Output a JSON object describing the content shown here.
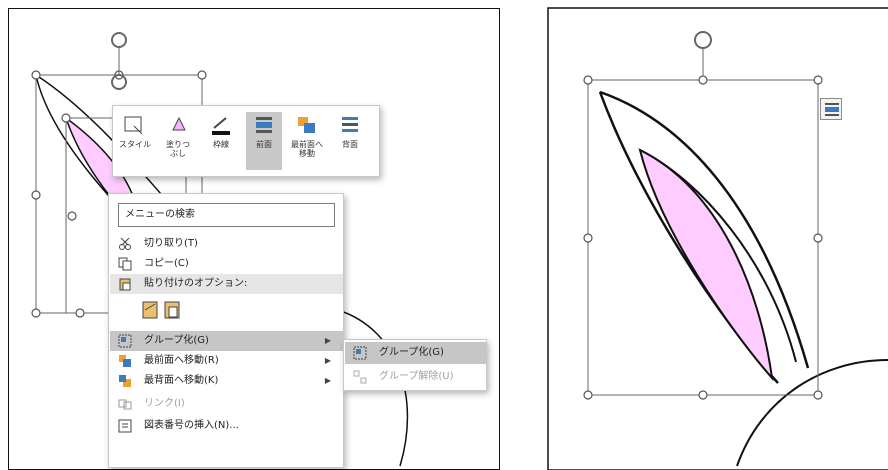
{
  "mini_toolbar": {
    "buttons": [
      {
        "label": "スタイル",
        "icon": "style-icon"
      },
      {
        "label": "塗りつ\nぶし",
        "icon": "fill-icon"
      },
      {
        "label": "枠線",
        "icon": "outline-icon"
      },
      {
        "label": "前面",
        "icon": "bring-forward-icon",
        "active": true
      },
      {
        "label": "最前面へ\n移動",
        "icon": "bring-to-front-icon"
      },
      {
        "label": "背面",
        "icon": "send-backward-icon"
      }
    ]
  },
  "context_menu": {
    "search_placeholder": "メニューの検索",
    "items": [
      {
        "label": "切り取り(T)",
        "icon": "scissors-icon"
      },
      {
        "label": "コピー(C)",
        "icon": "copy-icon"
      },
      {
        "label": "貼り付けのオプション:",
        "icon": "paste-icon"
      },
      {
        "label": "グループ化(G)",
        "icon": "group-icon"
      },
      {
        "label": "最前面へ移動(R)",
        "icon": "bring-to-front-icon"
      },
      {
        "label": "最背面へ移動(K)",
        "icon": "send-to-back-icon"
      },
      {
        "label": "リンク(I)",
        "icon": "link-icon"
      },
      {
        "label": "図表番号の挿入(N)...",
        "icon": "caption-icon"
      }
    ]
  },
  "submenu": {
    "items": [
      {
        "label": "グループ化(G)",
        "icon": "group-icon"
      },
      {
        "label": "グループ解除(U)",
        "icon": "ungroup-icon"
      }
    ]
  },
  "colors": {
    "ear_fill": "#ffccff",
    "highlight": "#c6c6c6",
    "handle_stroke": "#555555"
  }
}
